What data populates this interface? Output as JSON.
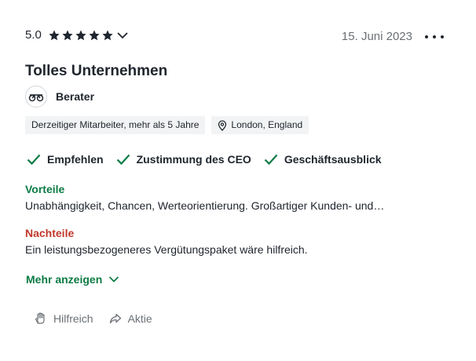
{
  "review": {
    "rating": "5.0",
    "stars": 5,
    "date": "15. Juni 2023",
    "title": "Tolles Unternehmen",
    "role": "Berater",
    "tags": {
      "employment": "Derzeitiger Mitarbeiter, mehr als 5 Jahre",
      "location": "London, England"
    },
    "checks": [
      "Empfehlen",
      "Zustimmung des CEO",
      "Geschäftsausblick"
    ],
    "pros_label": "Vorteile",
    "pros_text": "Unabhängigkeit, Chancen, Werteorientierung. Großartiger Kunden- und…",
    "cons_label": "Nachteile",
    "cons_text": "Ein leistungsbezogeneres Vergütungspaket wäre hilfreich.",
    "show_more": "Mehr anzeigen",
    "actions": {
      "helpful": "Hilfreich",
      "share": "Aktie"
    }
  },
  "icons": {
    "star": "star-icon",
    "chevron": "chevron-down-icon",
    "more": "more-icon",
    "role": "bicycle-icon",
    "location": "location-pin-icon",
    "check": "check-icon",
    "helpful": "helpful-hand-icon",
    "share": "share-icon"
  },
  "colors": {
    "green": "#0c7b45",
    "red": "#c0392b",
    "text": "#20262e",
    "muted": "#6b7075",
    "tag_bg": "#f2f3f4"
  }
}
